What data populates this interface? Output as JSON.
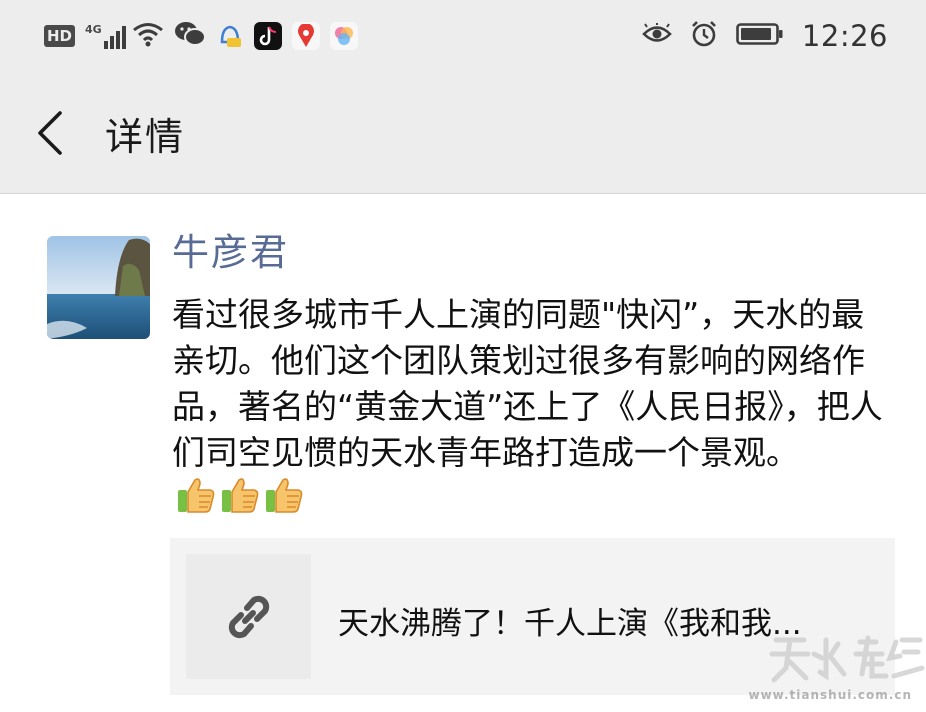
{
  "status_bar": {
    "hd_badge": "HD",
    "network_type": "4G",
    "time": "12:26",
    "icons": [
      "hd-icon",
      "signal-icon",
      "wifi-icon",
      "wechat-icon",
      "notification-app-icon",
      "tiktok-icon",
      "map-pin-app-icon",
      "gallery-app-icon",
      "eye-icon",
      "alarm-icon",
      "battery-icon"
    ]
  },
  "nav": {
    "back_icon": "chevron-left-icon",
    "title": "详情"
  },
  "post": {
    "author": "牛彦君",
    "body": "看过很多城市千人上演的同题\"快闪”，天水的最亲切。他们这个团队策划过很多有影响的网络作品，著名的“黄金大道”还上了《人民日报》，把人们司空见惯的天水青年路打造成一个景观。",
    "emoji_count": 3,
    "emoji": "thumbs-up-icon"
  },
  "link_card": {
    "icon": "link-icon",
    "title": "天水沸腾了！千人上演《我和我..."
  },
  "colors": {
    "bar_bg": "#ededed",
    "author_blue": "#576b95",
    "card_bg": "#f3f3f3"
  }
}
